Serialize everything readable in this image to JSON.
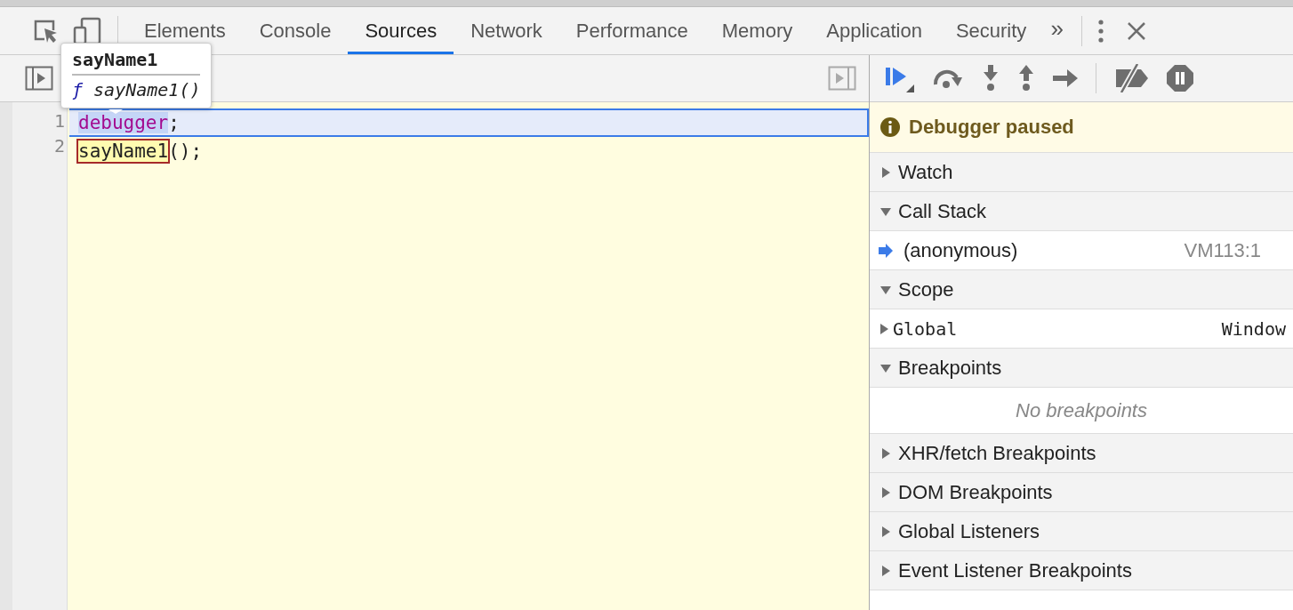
{
  "tabs": [
    {
      "label": "Elements",
      "selected": false
    },
    {
      "label": "Console",
      "selected": false
    },
    {
      "label": "Sources",
      "selected": true
    },
    {
      "label": "Network",
      "selected": false
    },
    {
      "label": "Performance",
      "selected": false
    },
    {
      "label": "Memory",
      "selected": false
    },
    {
      "label": "Application",
      "selected": false
    },
    {
      "label": "Security",
      "selected": false
    }
  ],
  "more_tabs": "»",
  "editor": {
    "lines": [
      {
        "number": "1",
        "paused": true,
        "tokens": [
          {
            "text": "debugger",
            "kind": "keyword"
          },
          {
            "text": ";",
            "kind": "plain"
          }
        ]
      },
      {
        "number": "2",
        "paused": false,
        "tokens": [
          {
            "text": "sayName1",
            "kind": "hovered"
          },
          {
            "text": "();",
            "kind": "plain"
          }
        ]
      }
    ],
    "tooltip": {
      "title": "sayName1",
      "type_mark": "ƒ",
      "signature": "sayName1()"
    }
  },
  "paused_message": "Debugger paused",
  "sections": [
    {
      "title": "Watch",
      "expanded": false
    },
    {
      "title": "Call Stack",
      "expanded": true,
      "frames": [
        {
          "name": "(anonymous)",
          "location": "VM113:1",
          "current": true
        }
      ]
    },
    {
      "title": "Scope",
      "expanded": true,
      "scopes": [
        {
          "name": "Global",
          "value": "Window",
          "expanded": false
        }
      ]
    },
    {
      "title": "Breakpoints",
      "expanded": true,
      "empty_message": "No breakpoints"
    },
    {
      "title": "XHR/fetch Breakpoints",
      "expanded": false
    },
    {
      "title": "DOM Breakpoints",
      "expanded": false
    },
    {
      "title": "Global Listeners",
      "expanded": false
    },
    {
      "title": "Event Listener Breakpoints",
      "expanded": false
    }
  ]
}
